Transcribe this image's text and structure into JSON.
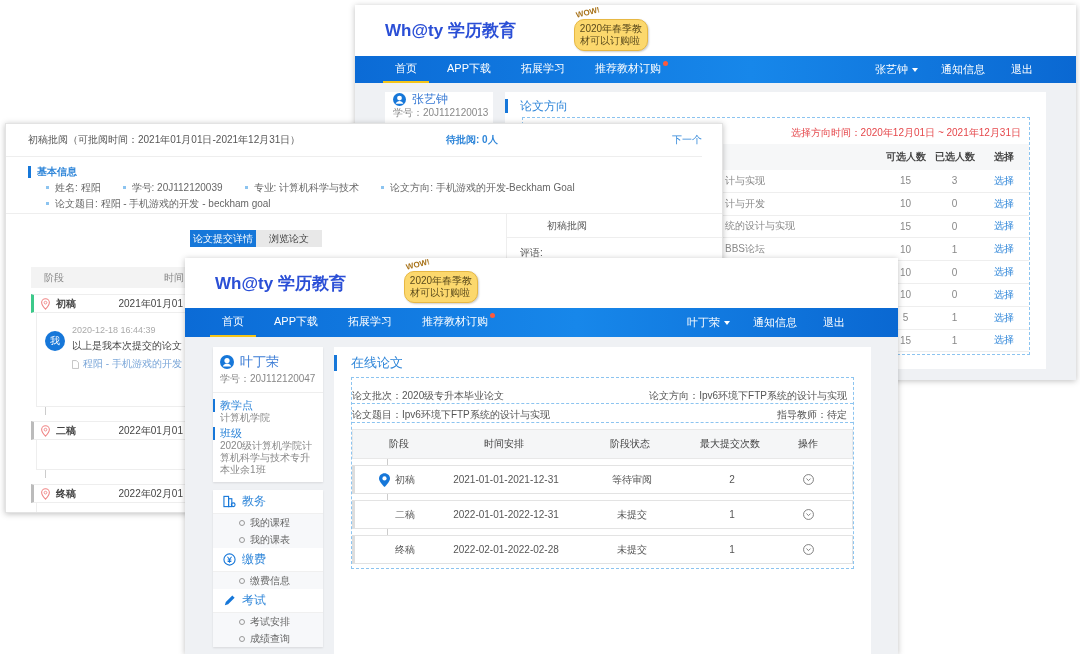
{
  "direction_window": {
    "header": {
      "logo": "Wh@ty 学历教育",
      "promo": {
        "exclaim": "WOW!",
        "lines": [
          "2020年春季教",
          "材可以订购啦"
        ]
      },
      "nav": [
        {
          "label": "首页",
          "selected": true,
          "dot": false
        },
        {
          "label": "APP下载",
          "selected": false,
          "dot": false
        },
        {
          "label": "拓展学习",
          "selected": false,
          "dot": false
        },
        {
          "label": "推荐教材订购",
          "selected": false,
          "dot": true
        }
      ],
      "user": "张艺钟",
      "links": [
        "通知信息",
        "退出"
      ]
    },
    "profile": {
      "name": "张艺钟",
      "student_id": "学号：20J112120013"
    },
    "title": "论文方向",
    "deadline": "选择方向时间：2020年12月01日 ~ 2021年12月31日",
    "columns": [
      "可选人数",
      "已选人数",
      "选择"
    ],
    "rows": [
      {
        "direction": "计与实现",
        "capacity": "15",
        "chosen": "3",
        "action": "选择"
      },
      {
        "direction": "计与开发",
        "capacity": "10",
        "chosen": "0",
        "action": "选择"
      },
      {
        "direction": "统的设计与实现",
        "capacity": "15",
        "chosen": "0",
        "action": "选择"
      },
      {
        "direction": "BBS论坛",
        "capacity": "10",
        "chosen": "1",
        "action": "选择"
      },
      {
        "capacity": "10",
        "chosen": "0",
        "action": "选择"
      },
      {
        "capacity": "10",
        "chosen": "0",
        "action": "选择"
      },
      {
        "capacity": "5",
        "chosen": "1",
        "action": "选择"
      },
      {
        "capacity": "15",
        "chosen": "1",
        "action": "选择"
      }
    ]
  },
  "review_window": {
    "title": "初稿批阅（可批阅时间：2021年01月01日-2021年12月31日）",
    "pending": "待批阅: 0人",
    "next": "下一个",
    "section": "基本信息",
    "info": [
      "姓名: 程阳",
      "学号: 20J112120039",
      "专业: 计算机科学与技术",
      "论文方向: 手机游戏的开发-Beckham Goal",
      "论文题目: 程阳 - 手机游戏的开发 - beckham goal"
    ],
    "tabs": [
      {
        "label": "论文提交详情",
        "selected": true
      },
      {
        "label": "浏览论文",
        "selected": false
      }
    ],
    "side_panel": {
      "title": "初稿批阅",
      "comment_label": "评语:"
    },
    "table_header": [
      "阶段",
      "时间"
    ],
    "stages": [
      {
        "name": "初稿",
        "date": "2021年01月01",
        "active": true,
        "comment": {
          "avatar": "我",
          "time": "2020-12-18 16:44:39",
          "text": "以上是我本次提交的论文",
          "file": "程阳 - 手机游戏的开发"
        }
      },
      {
        "name": "二稿",
        "date": "2022年01月01",
        "active": false
      },
      {
        "name": "终稿",
        "date": "2022年02月01",
        "active": false
      }
    ]
  },
  "thesis_window": {
    "header": {
      "logo": "Wh@ty 学历教育",
      "promo": {
        "exclaim": "WOW!",
        "lines": [
          "2020年春季教",
          "材可以订购啦"
        ]
      },
      "nav": [
        {
          "label": "首页",
          "selected": true,
          "dot": false
        },
        {
          "label": "APP下载",
          "selected": false,
          "dot": false
        },
        {
          "label": "拓展学习",
          "selected": false,
          "dot": false
        },
        {
          "label": "推荐教材订购",
          "selected": false,
          "dot": true
        }
      ],
      "user": "叶丁荣",
      "links": [
        "通知信息",
        "退出"
      ]
    },
    "profile": {
      "name": "叶丁荣",
      "student_id": "学号：20J112120047",
      "fields": [
        {
          "label": "教学点",
          "value": "计算机学院"
        },
        {
          "label": "班级",
          "value": "2020级计算机学院计算机科学与技术专升本业余1班"
        }
      ]
    },
    "menu": [
      {
        "label": "教务",
        "kind": "book",
        "items": [
          "我的课程",
          "我的课表"
        ]
      },
      {
        "label": "缴费",
        "kind": "fee",
        "items": [
          "缴费信息"
        ]
      },
      {
        "label": "考试",
        "kind": "exam",
        "items": [
          "考试安排",
          "成绩查询"
        ]
      }
    ],
    "title": "在线论文",
    "meta": [
      {
        "left": "论文批次：2020级专升本毕业论文",
        "right": "论文方向：Ipv6环境下FTP系统的设计与实现"
      },
      {
        "left": "论文题目：Ipv6环境下FTP系统的设计与实现",
        "right": "指导教师：待定"
      }
    ],
    "columns": [
      "阶段",
      "时间安排",
      "阶段状态",
      "最大提交次数",
      "操作"
    ],
    "stages": [
      {
        "name": "初稿",
        "period": "2021-01-01-2021-12-31",
        "status": "等待审阅",
        "max": "2",
        "current": true
      },
      {
        "name": "二稿",
        "period": "2022-01-01-2022-12-31",
        "status": "未提交",
        "max": "1",
        "current": false
      },
      {
        "name": "终稿",
        "period": "2022-02-01-2022-02-28",
        "status": "未提交",
        "max": "1",
        "current": false
      }
    ]
  }
}
